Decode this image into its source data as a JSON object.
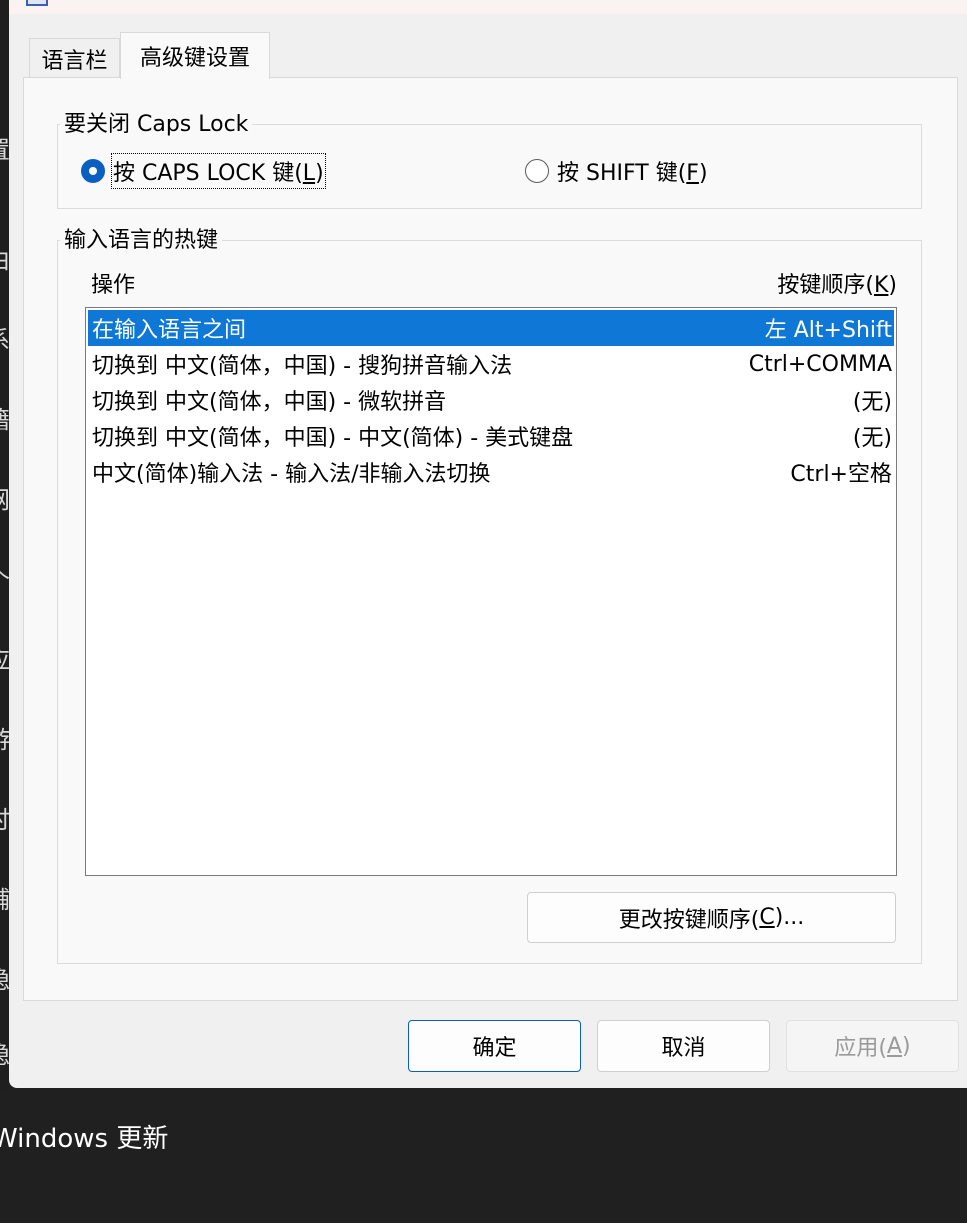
{
  "tabs": [
    {
      "label": "语言栏"
    },
    {
      "label": "高级键设置"
    }
  ],
  "caps_group": {
    "title": "要关闭 Caps Lock",
    "option1": {
      "prefix": "按 CAPS LOCK 键(",
      "mnemonic": "L",
      "suffix": ")"
    },
    "option2": {
      "prefix": "按 SHIFT 键(",
      "mnemonic": "F",
      "suffix": ")"
    }
  },
  "hotkey_group": {
    "title": "输入语言的热键",
    "col_action": "操作",
    "col_key_prefix": "按键顺序(",
    "col_key_mnemonic": "K",
    "col_key_suffix": ")",
    "rows": [
      {
        "action": "在输入语言之间",
        "keys": "左 Alt+Shift",
        "selected": true
      },
      {
        "action": "切换到 中文(简体，中国) - 搜狗拼音输入法",
        "keys": "Ctrl+COMMA",
        "selected": false
      },
      {
        "action": "切换到 中文(简体，中国) - 微软拼音",
        "keys": "(无)",
        "selected": false
      },
      {
        "action": "切换到 中文(简体，中国) - 中文(简体) - 美式键盘",
        "keys": "(无)",
        "selected": false
      },
      {
        "action": "中文(简体)输入法 - 输入法/非输入法切换",
        "keys": "Ctrl+空格",
        "selected": false
      }
    ],
    "change_button": {
      "prefix": "更改按键顺序(",
      "mnemonic": "C",
      "suffix": ")..."
    }
  },
  "footer": {
    "ok": "确定",
    "cancel": "取消",
    "apply_prefix": "应用(",
    "apply_mnemonic": "A",
    "apply_suffix": ")"
  },
  "background": {
    "taskbar_text": "Windows 更新",
    "side_glyphs": [
      "置",
      "由",
      "系",
      "籍",
      "网",
      "个",
      "应",
      "游",
      "时",
      "辅",
      "隐",
      "隐"
    ]
  },
  "colors": {
    "selection": "#0f78d7",
    "accent": "#0a5fc1",
    "dialog_bg": "#f0f0f0",
    "panel_bg": "#f9f9f9",
    "desktop_bg": "#202020"
  }
}
